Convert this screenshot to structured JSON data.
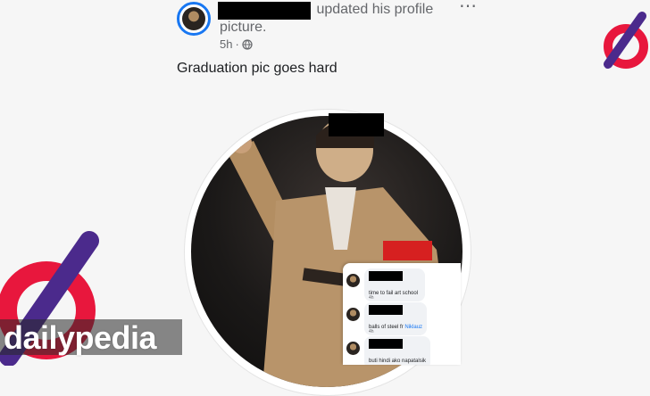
{
  "post": {
    "header_text": "updated his profile picture.",
    "timestamp": "5h",
    "privacy_separator": "·",
    "caption": "Graduation pic goes hard",
    "more_icon": "⋯"
  },
  "comments": [
    {
      "text": "time to fail art school",
      "tag": "",
      "time": "4h"
    },
    {
      "text": "balls of steel fr ",
      "tag": "Niklauz",
      "time": "4h"
    },
    {
      "text": "buti hindi ako napatalsik",
      "tag": "",
      "time": ""
    }
  ],
  "watermark": {
    "brand": "dailypedia"
  },
  "colors": {
    "accent": "#1877f2",
    "brand_red": "#e8173d",
    "brand_purple": "#4b2a8c"
  }
}
